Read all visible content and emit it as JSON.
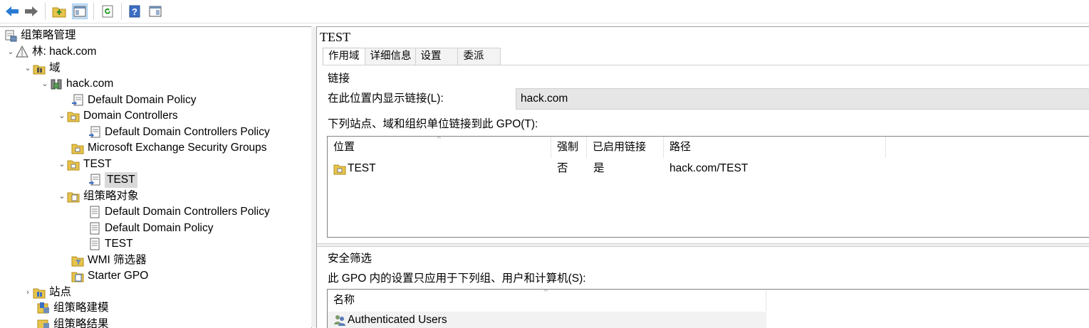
{
  "toolbar": {
    "buttons": [
      {
        "icon": "back-arrow-icon"
      },
      {
        "icon": "forward-arrow-icon"
      },
      {
        "icon": "up-folder-icon"
      },
      {
        "icon": "show-hide-console-tree-icon"
      },
      {
        "icon": "refresh-icon"
      },
      {
        "icon": "help-icon"
      },
      {
        "icon": "show-action-pane-icon"
      }
    ]
  },
  "tree": {
    "root": "组策略管理",
    "forest": "林: hack.com",
    "domains": "域",
    "domain": "hack.com",
    "ddp": "Default Domain Policy",
    "dc": "Domain Controllers",
    "ddcp": "Default Domain Controllers Policy",
    "mesg": "Microsoft Exchange Security Groups",
    "test_ou": "TEST",
    "test_link": "TEST",
    "gpo_objects": "组策略对象",
    "gpo_ddcp": "Default Domain Controllers Policy",
    "gpo_ddp": "Default Domain Policy",
    "gpo_test": "TEST",
    "wmi": "WMI 筛选器",
    "starter": "Starter GPO",
    "sites": "站点",
    "modeling": "组策略建模",
    "results": "组策略结果"
  },
  "details": {
    "title": "TEST",
    "tabs": [
      "作用域",
      "详细信息",
      "设置",
      "委派"
    ],
    "links_heading": "链接",
    "display_links_label": "在此位置内显示链接(L):",
    "display_links_value": "hack.com",
    "linked_label": "下列站点、域和组织单位链接到此 GPO(T):",
    "links_table": {
      "headers": [
        "位置",
        "强制",
        "已启用链接",
        "路径"
      ],
      "rows": [
        {
          "location": "TEST",
          "enforced": "否",
          "enabled": "是",
          "path": "hack.com/TEST"
        }
      ]
    },
    "security_heading": "安全筛选",
    "security_label": "此 GPO 内的设置只应用于下列组、用户和计算机(S):",
    "security_table": {
      "headers": [
        "名称"
      ],
      "rows": [
        {
          "name": "Authenticated Users"
        }
      ]
    }
  },
  "colors": {
    "selection": "#d9d9d9",
    "tab_active_bg": "#ffffff",
    "field_bg": "#e6e6e6",
    "icon_yellow": "#e8c44a"
  }
}
